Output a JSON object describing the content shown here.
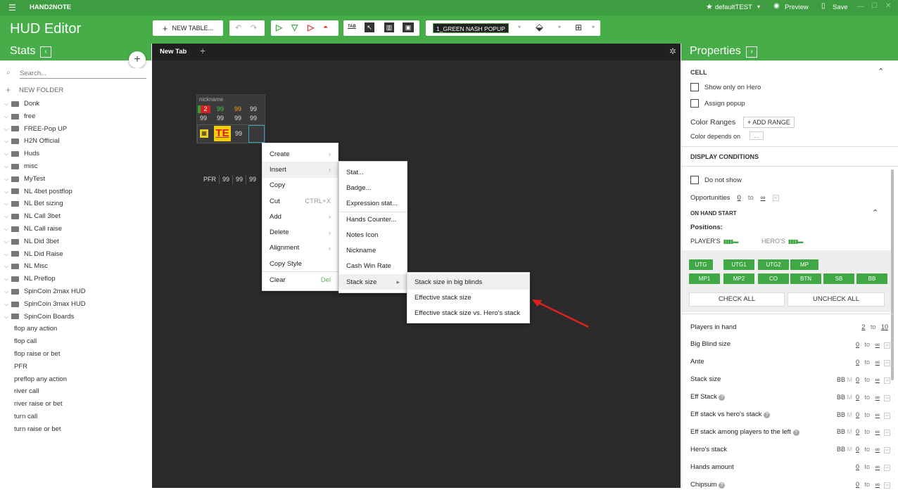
{
  "app": {
    "name": "HAND2NOTE",
    "title": "HUD Editor",
    "profile": "defaultTEST",
    "preview_label": "Preview",
    "save_label": "Save"
  },
  "toolbar": {
    "new_table_label": "NEW TABLE...",
    "tab_icon_label": "TAB",
    "popup_name": "1_GREEN NASH POPUP"
  },
  "stats": {
    "header": "Stats",
    "search_placeholder": "Search...",
    "new_folder_label": "NEW FOLDER",
    "folders": [
      "Donk",
      "free",
      "FREE-Pop UP",
      "H2N Official",
      "Huds",
      "misc",
      "MyTest",
      "NL 4bet postflop",
      "NL Bet sizing",
      "NL Call 3bet",
      "NL Call raise",
      "NL Did 3bet",
      "NL Did Raise",
      "NL Misc",
      "NL Preflop",
      "SpinCoin 2max HUD",
      "SpinCoin 3max HUD",
      "SpinCoin Boards"
    ],
    "items": [
      "flop any action",
      "flop call",
      "flop raise or bet",
      "PFR",
      "preflop any action",
      "river call",
      "river raise or bet",
      "turn call",
      "turn raise or bet"
    ]
  },
  "canvas": {
    "tab_label": "New Tab",
    "hud": {
      "nickname": "nickname",
      "r1": [
        "2",
        "99",
        "99",
        "99"
      ],
      "r2": [
        "99",
        "99",
        "99",
        "99"
      ],
      "r3_text": "TE",
      "r3_val": "99",
      "pfr": [
        "PFR",
        "99",
        "99",
        "99"
      ]
    }
  },
  "context_menu": {
    "main": [
      {
        "label": "Create",
        "arrow": "›"
      },
      {
        "label": "Insert",
        "arrow": "›"
      },
      {
        "label": "Copy"
      },
      {
        "label": "Cut",
        "shortcut": "CTRL+X"
      },
      {
        "label": "Add",
        "arrow": "›"
      },
      {
        "label": "Delete",
        "arrow": "›"
      },
      {
        "label": "Alignment",
        "arrow": "›"
      },
      {
        "label": "Copy Style"
      },
      {
        "label": "Clear",
        "shortcut": "Del"
      }
    ],
    "insert": [
      "Stat...",
      "Badge...",
      "Expression stat...",
      "Hands Counter...",
      "Notes Icon",
      "Nickname",
      "Cash Win Rate",
      "Stack size"
    ],
    "stack_size": [
      "Stack size in big blinds",
      "Effective stack size",
      "Effective stack size vs. Hero's stack"
    ]
  },
  "properties": {
    "header": "Properties",
    "cell_section": "CELL",
    "show_only_hero": "Show only on Hero",
    "assign_popup": "Assign popup",
    "color_ranges": "Color Ranges",
    "add_range": "+ ADD RANGE",
    "color_depends": "Color depends on",
    "color_depends_btn": "...",
    "display_conditions": "DISPLAY CONDITIONS",
    "do_not_show": "Do not show",
    "opportunities": "Opportunities",
    "opp_from": "0",
    "opp_to": "∞",
    "on_hand_start": "ON HAND START",
    "positions": "Positions:",
    "players": "PLAYER'S",
    "heros": "HERO'S",
    "pos_row1": [
      "UTG",
      "UTG1",
      "UTG2",
      "MP"
    ],
    "pos_row2": [
      "MP1",
      "MP2",
      "CO",
      "BTN",
      "SB",
      "BB"
    ],
    "check_all": "CHECK ALL",
    "uncheck_all": "UNCHECK ALL",
    "ranges": [
      {
        "label": "Players in hand",
        "units": "",
        "from": "2",
        "to": "10",
        "help": false
      },
      {
        "label": "Big Blind size",
        "units": "",
        "from": "0",
        "to": "∞",
        "help": false
      },
      {
        "label": "Ante",
        "units": "",
        "from": "0",
        "to": "∞",
        "help": false
      },
      {
        "label": "Stack size",
        "units": "BB M",
        "from": "0",
        "to": "∞",
        "help": false
      },
      {
        "label": "Eff Stack",
        "units": "BB M",
        "from": "0",
        "to": "∞",
        "help": true
      },
      {
        "label": "Eff stack vs hero's stack",
        "units": "BB M",
        "from": "0",
        "to": "∞",
        "help": true
      },
      {
        "label": "Eff stack among players to the left",
        "units": "BB M",
        "from": "0",
        "to": "∞",
        "help": true
      },
      {
        "label": "Hero's stack",
        "units": "BB M",
        "from": "0",
        "to": "∞",
        "help": false
      },
      {
        "label": "Hands amount",
        "units": "",
        "from": "0",
        "to": "∞",
        "help": false
      },
      {
        "label": "Chipsum",
        "units": "",
        "from": "0",
        "to": "∞",
        "help": true
      }
    ],
    "to_word": "to"
  },
  "colors": {
    "green": "#46ad48",
    "dark": "#2b2b2b",
    "red_arrow": "#e0201a"
  }
}
